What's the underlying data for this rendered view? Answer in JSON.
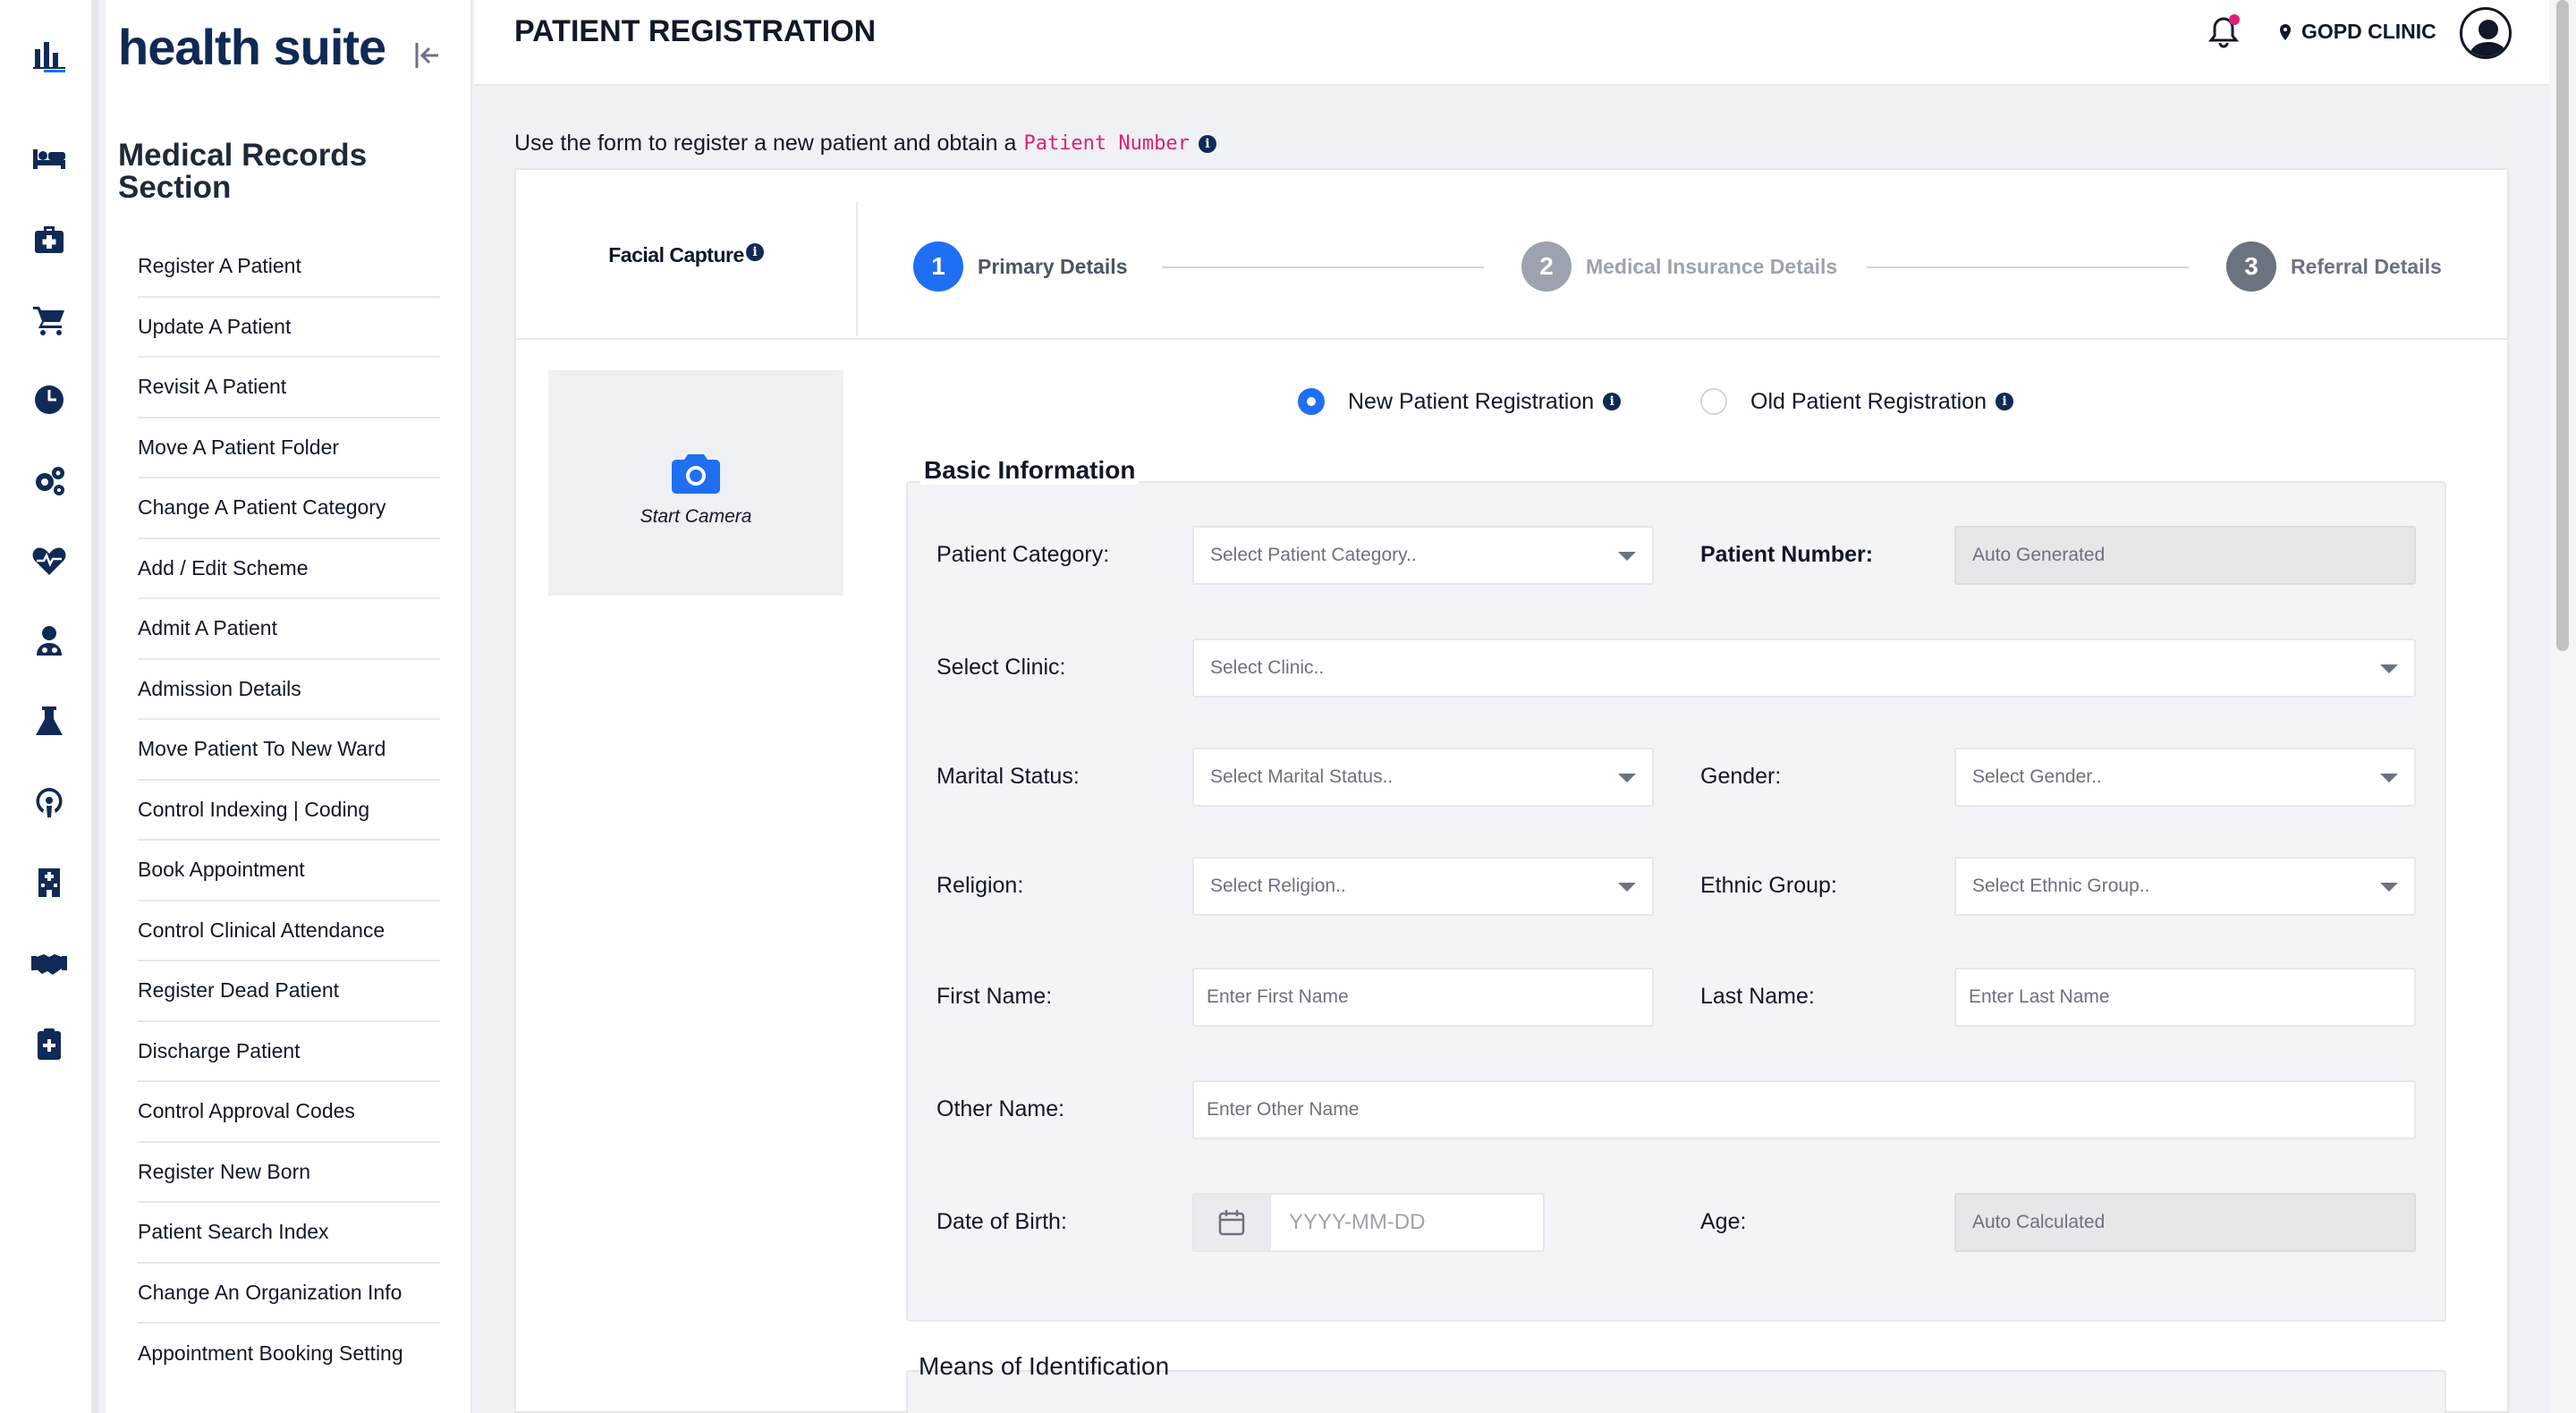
{
  "app": {
    "brand": "health suite"
  },
  "rail": {
    "icons": [
      "chart-bar-icon",
      "bed-icon",
      "first-aid-kit-icon",
      "cart-icon",
      "clock-icon",
      "cogs-icon",
      "heartbeat-icon",
      "doctor-icon",
      "flask-icon",
      "podcast-icon",
      "hospital-icon",
      "handshake-icon",
      "clipboard-medical-icon"
    ]
  },
  "sidebar": {
    "section_title": "Medical Records Section",
    "items": [
      "Register A Patient",
      "Update A Patient",
      "Revisit A Patient",
      "Move A Patient Folder",
      "Change A Patient Category",
      "Add / Edit Scheme",
      "Admit A Patient",
      "Admission Details",
      "Move Patient To New Ward",
      "Control Indexing | Coding",
      "Book Appointment",
      "Control Clinical Attendance",
      "Register Dead Patient",
      "Discharge Patient",
      "Control Approval Codes",
      "Register New Born",
      "Patient Search Index",
      "Change An Organization Info",
      "Appointment Booking Setting"
    ]
  },
  "header": {
    "title": "PATIENT REGISTRATION",
    "clinic": "GOPD CLINIC",
    "notification_dot_color": "#e11d74"
  },
  "intro": {
    "text": "Use the form to register a new patient and obtain a",
    "code": "Patient Number"
  },
  "tabs": {
    "facial": "Facial Capture",
    "steps": [
      {
        "num": "1",
        "label": "Primary Details",
        "state": "active"
      },
      {
        "num": "2",
        "label": "Medical Insurance Details",
        "state": "pending"
      },
      {
        "num": "3",
        "label": "Referral Details",
        "state": "pending"
      }
    ]
  },
  "camera": {
    "label": "Start Camera"
  },
  "registration_type": {
    "options": [
      "New Patient Registration",
      "Old Patient Registration"
    ],
    "selected": "New Patient Registration"
  },
  "basic": {
    "legend": "Basic Information",
    "patient_category": {
      "label": "Patient Category:",
      "placeholder": "Select Patient Category.."
    },
    "patient_number": {
      "label": "Patient Number:",
      "value": "Auto Generated"
    },
    "clinic": {
      "label": "Select Clinic:",
      "placeholder": "Select Clinic.."
    },
    "marital": {
      "label": "Marital Status:",
      "placeholder": "Select Marital Status.."
    },
    "gender": {
      "label": "Gender:",
      "placeholder": "Select Gender.."
    },
    "religion": {
      "label": "Religion:",
      "placeholder": "Select Religion.."
    },
    "ethnic": {
      "label": "Ethnic Group:",
      "placeholder": "Select Ethnic Group.."
    },
    "first_name": {
      "label": "First Name:",
      "placeholder": "Enter First Name"
    },
    "last_name": {
      "label": "Last Name:",
      "placeholder": "Enter Last Name"
    },
    "other_name": {
      "label": "Other Name:",
      "placeholder": "Enter Other Name"
    },
    "dob": {
      "label": "Date of Birth:",
      "placeholder": "YYYY-MM-DD"
    },
    "age": {
      "label": "Age:",
      "value": "Auto Calculated"
    }
  },
  "identification": {
    "legend": "Means of Identification"
  },
  "colors": {
    "accent": "#1f6ff2",
    "brand": "#0f2a56",
    "code": "#e11d74"
  }
}
